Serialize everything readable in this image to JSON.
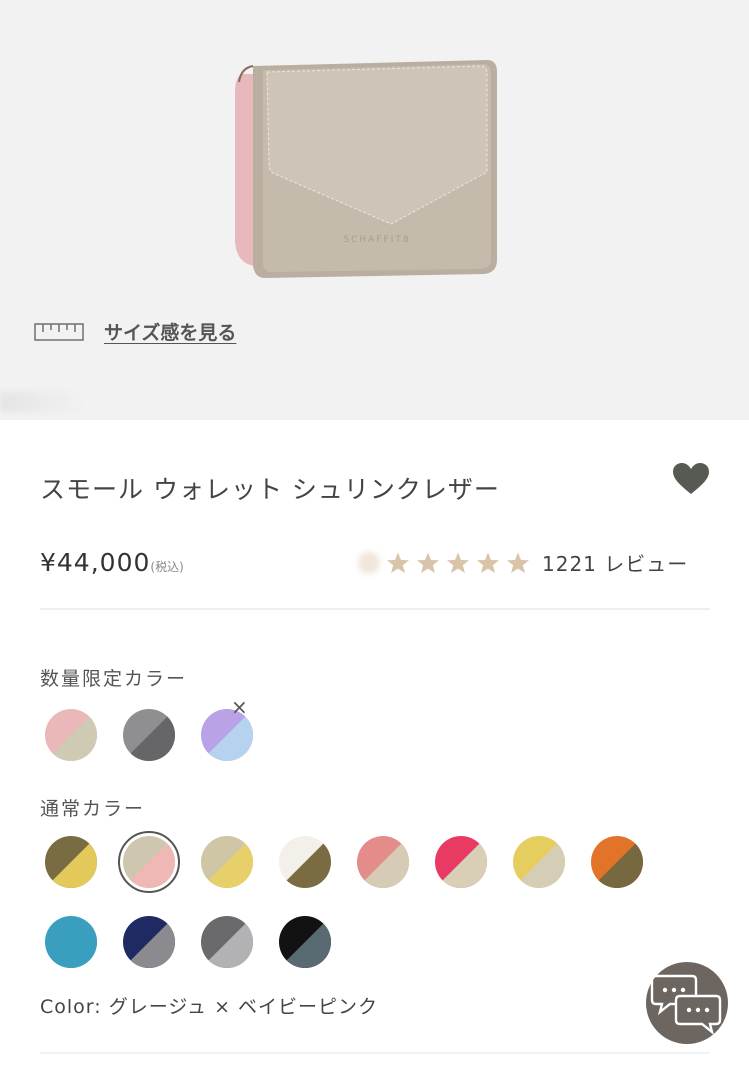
{
  "product": {
    "brand_mark": "SCHAFFIT8",
    "title": "スモール ウォレット シュリンクレザー",
    "price": "¥44,000",
    "tax_note": "(税込)",
    "review_count_text": "1221 レビュー",
    "rating_stars": 5
  },
  "size_link": {
    "label": "サイズ感を見る"
  },
  "limited_colors": {
    "label": "数量限定カラー",
    "swatches": [
      {
        "a": "#eab8b8",
        "b": "#cfcab3",
        "sold_out": false
      },
      {
        "a": "#8f8f92",
        "b": "#666669",
        "sold_out": false
      },
      {
        "a": "#b9a3e6",
        "b": "#b5d3ef",
        "sold_out": true
      }
    ]
  },
  "regular_colors": {
    "label": "通常カラー",
    "swatches": [
      {
        "a": "#7a6c42",
        "b": "#e3c95a"
      },
      {
        "a": "#cfc6b0",
        "b": "#f0b8b4",
        "selected": true
      },
      {
        "a": "#cfc6a6",
        "b": "#e7cf6a"
      },
      {
        "a": "#f2f0e8",
        "b": "#7a6c42"
      },
      {
        "a": "#e38c8a",
        "b": "#d6cbb4"
      },
      {
        "a": "#e83a63",
        "b": "#d8cfb6"
      },
      {
        "a": "#e6cd60",
        "b": "#d6cdb6"
      },
      {
        "a": "#e2742a",
        "b": "#77683f"
      },
      {
        "a": "#3a9ebf",
        "b": "#3a9ebf"
      },
      {
        "a": "#1f2a63",
        "b": "#8a8a8f"
      },
      {
        "a": "#6a6a6d",
        "b": "#b2b2b5"
      },
      {
        "a": "#121212",
        "b": "#5a6a72"
      }
    ]
  },
  "selected_color": {
    "prefix": "Color:",
    "value": "グレージュ × ベイビーピンク"
  },
  "colors": {
    "accent": "#6d6660",
    "hero_bg": "#f2f2f2",
    "star": "#d8c4a8",
    "heart": "#575a52"
  }
}
